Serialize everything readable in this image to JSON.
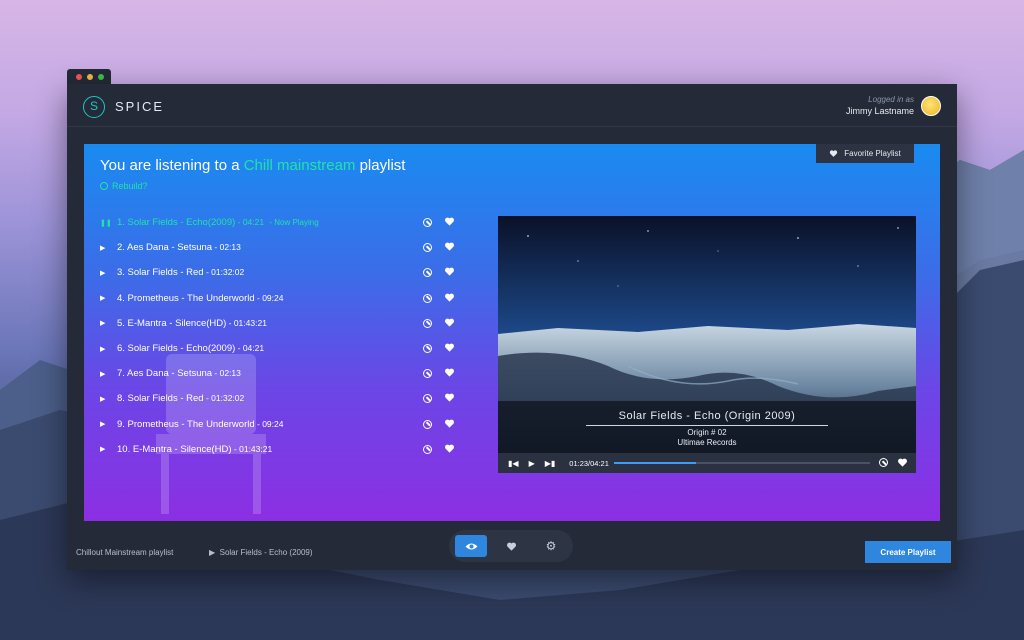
{
  "window": {
    "app_name": "SPICE",
    "logo_letter": "S",
    "login_caption": "Logged in as",
    "user_name": "Jimmy Lastname"
  },
  "panel": {
    "headline_prefix": "You are listening to a ",
    "headline_accent": "Chill mainstream",
    "headline_suffix": " playlist",
    "rebuild_label": "Rebuild?",
    "favorite_button": "Favorite Playlist"
  },
  "tracks": [
    {
      "title": "1. Solar Fields - Echo(2009)",
      "duration": " - 04:21",
      "status": " - Now Playing",
      "active": true
    },
    {
      "title": "2. Aes Dana - Setsuna",
      "duration": " - 02:13",
      "status": "",
      "active": false
    },
    {
      "title": "3. Solar Fields - Red",
      "duration": " - 01:32:02",
      "status": "",
      "active": false
    },
    {
      "title": "4. Prometheus - The Underworld",
      "duration": " - 09:24",
      "status": "",
      "active": false
    },
    {
      "title": "5. E-Mantra - Silence(HD)",
      "duration": " - 01:43:21",
      "status": "",
      "active": false
    },
    {
      "title": "6. Solar Fields - Echo(2009)",
      "duration": " - 04:21",
      "status": "",
      "active": false
    },
    {
      "title": "7. Aes Dana - Setsuna",
      "duration": " - 02:13",
      "status": "",
      "active": false
    },
    {
      "title": "8. Solar Fields - Red",
      "duration": " - 01:32:02",
      "status": "",
      "active": false
    },
    {
      "title": "9. Prometheus - The Underworld",
      "duration": " - 09:24",
      "status": "",
      "active": false
    },
    {
      "title": "10. E-Mantra - Silence(HD)",
      "duration": " - 01:43:21",
      "status": "",
      "active": false
    }
  ],
  "video": {
    "title": "Solar Fields - Echo (Origin 2009)",
    "subtitle": "Origin # 02",
    "label": "Ultimae Records",
    "time": "01:23/04:21",
    "progress": 0.32
  },
  "footer": {
    "playlist_name": "Chillout Mainstream playlist",
    "now_playing": "Solar Fields - Echo (2009)",
    "create_button": "Create Playlist"
  },
  "icons": {
    "play": "play-icon",
    "pause": "pause-icon",
    "block": "block-icon",
    "heart": "heart-icon",
    "eye": "eye-icon",
    "gear": "gear-icon"
  },
  "colors": {
    "accent": "#20e3a8",
    "brand": "#1fc6c9",
    "button": "#2e86de",
    "window_bg": "#242a37"
  }
}
